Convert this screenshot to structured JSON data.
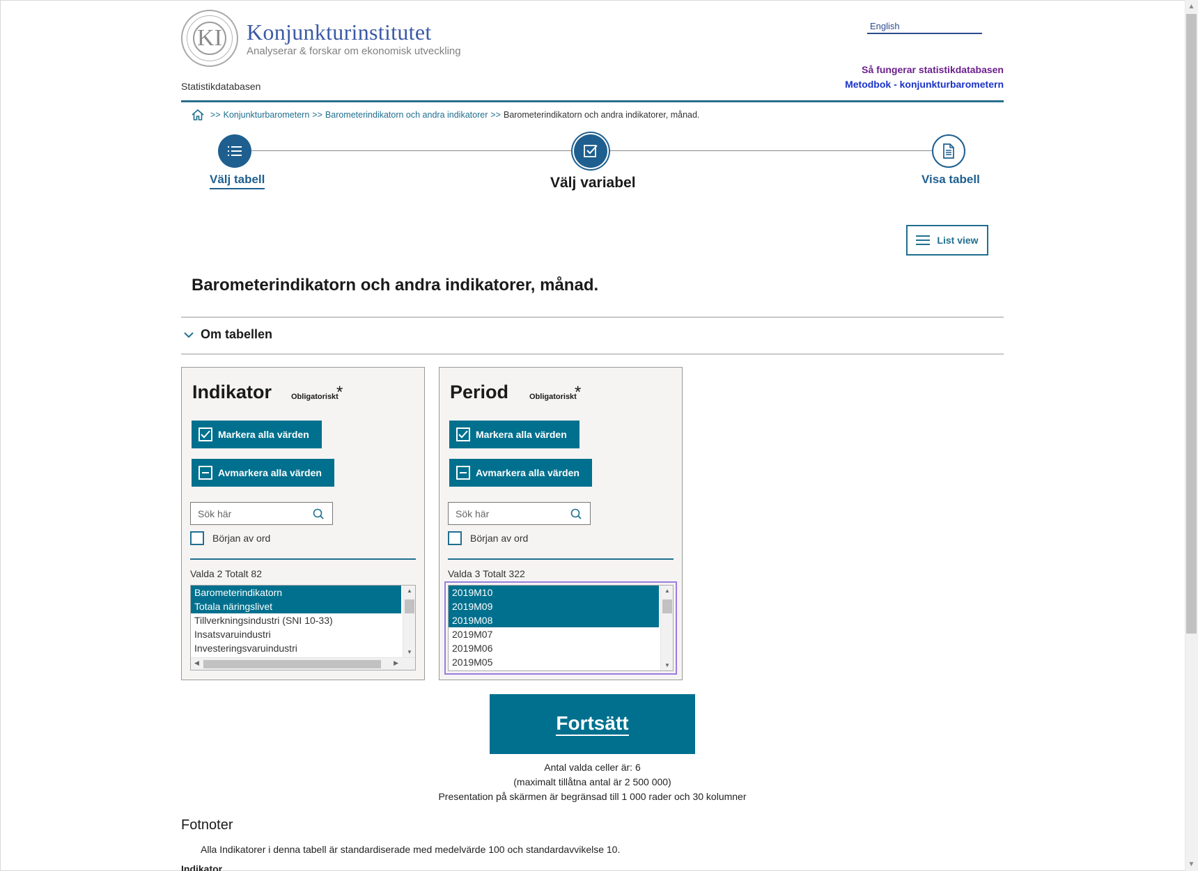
{
  "header": {
    "logo_seal_text": "KI",
    "logo_seal_ring_text": "KONJUNKTUR INSTITUTET",
    "logo_title": "Konjunkturinstitutet",
    "logo_subtitle": "Analyserar & forskar om ekonomisk utveckling",
    "site_name": "Statistikdatabasen",
    "language_link": "English",
    "help_links": [
      "Så fungerar statistikdatabasen",
      "Metodbok - konjunkturbarometern"
    ]
  },
  "breadcrumb": {
    "sep": ">>",
    "items": [
      "Konjunkturbarometern",
      "Barometerindikatorn och andra indikatorer"
    ],
    "current": "Barometerindikatorn och andra indikatorer, månad."
  },
  "steps": [
    {
      "label": "Välj tabell",
      "icon": "list-icon",
      "state": "done"
    },
    {
      "label": "Välj variabel",
      "icon": "checkbox-icon",
      "state": "current"
    },
    {
      "label": "Visa tabell",
      "icon": "document-icon",
      "state": "todo"
    }
  ],
  "list_view_label": "List view",
  "page_title": "Barometerindikatorn och andra indikatorer, månad.",
  "about_table": "Om tabellen",
  "variables": [
    {
      "title": "Indikator",
      "required": "Obligatoriskt",
      "star": "*",
      "select_all": "Markera alla värden",
      "deselect_all": "Avmarkera alla värden",
      "search_placeholder": "Sök här",
      "begin_word": "Början av ord",
      "counts": "Valda 2 Totalt 82",
      "options": [
        {
          "label": "Barometerindikatorn",
          "selected": true
        },
        {
          "label": "Totala näringslivet",
          "selected": true
        },
        {
          "label": "Tillverkningsindustri (SNI 10-33)",
          "selected": false
        },
        {
          "label": "Insatsvaruindustri",
          "selected": false
        },
        {
          "label": "Investeringsvaruindustri",
          "selected": false
        }
      ]
    },
    {
      "title": "Period",
      "required": "Obligatoriskt",
      "star": "*",
      "select_all": "Markera alla värden",
      "deselect_all": "Avmarkera alla värden",
      "search_placeholder": "Sök här",
      "begin_word": "Början av ord",
      "counts": "Valda 3 Totalt 322",
      "options": [
        {
          "label": "2019M10",
          "selected": true
        },
        {
          "label": "2019M09",
          "selected": true
        },
        {
          "label": "2019M08",
          "selected": true
        },
        {
          "label": "2019M07",
          "selected": false
        },
        {
          "label": "2019M06",
          "selected": false
        },
        {
          "label": "2019M05",
          "selected": false
        }
      ]
    }
  ],
  "continue_label": "Fortsätt",
  "cells_info": [
    "Antal valda celler är:  6",
    "(maximalt tillåtna antal är 2 500 000)",
    "Presentation på skärmen är begränsad till 1 000 rader och 30 kolumner"
  ],
  "footnotes_title": "Fotnoter",
  "footnote_text": "Alla Indikatorer i denna tabell är standardiserade med medelvärde 100 och standardavvikelse 10.",
  "footnote_cut": "Indikator",
  "colors": {
    "accent": "#00708e",
    "step": "#1e5f8f",
    "link": "#1f6f8f",
    "visited": "#6b1f8d",
    "link2": "#1a33c8"
  }
}
